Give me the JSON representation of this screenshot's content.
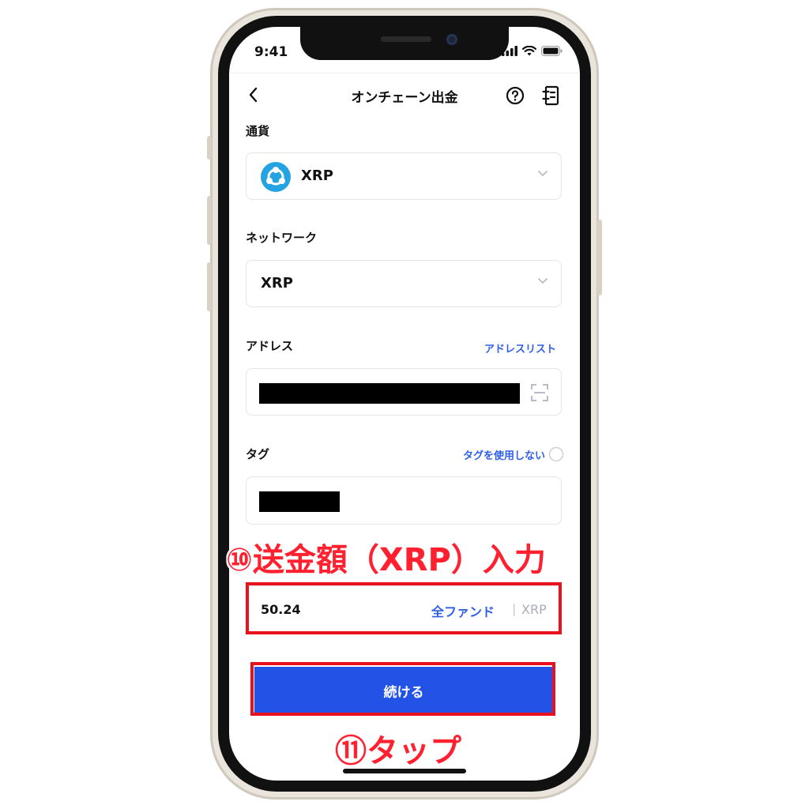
{
  "status_bar": {
    "time": "9:41"
  },
  "nav": {
    "title": "オンチェーン出金",
    "back_icon": "chevron-left-icon",
    "help_icon": "question-circle-icon",
    "history_icon": "record-list-icon"
  },
  "currency": {
    "label": "通貨",
    "value": "XRP",
    "icon": "xrp-logo-icon",
    "icon_color": "#23a3e2"
  },
  "network": {
    "label": "ネットワーク",
    "value": "XRP"
  },
  "address": {
    "label": "アドレス",
    "link": "アドレスリスト",
    "value": ""
  },
  "tag": {
    "label": "タグ",
    "link": "タグを使用しない",
    "value": ""
  },
  "amount": {
    "value": "50.24",
    "all_funds": "全ファンド",
    "divider": "|",
    "unit": "XRP"
  },
  "continue_button": {
    "label": "続ける",
    "color": "#2352e6"
  },
  "annotations": {
    "step10": "⑩送金額（XRP）入力",
    "step11": "⑪タップ",
    "color": "#e8111d"
  },
  "colors": {
    "link": "#2f5ee8"
  }
}
